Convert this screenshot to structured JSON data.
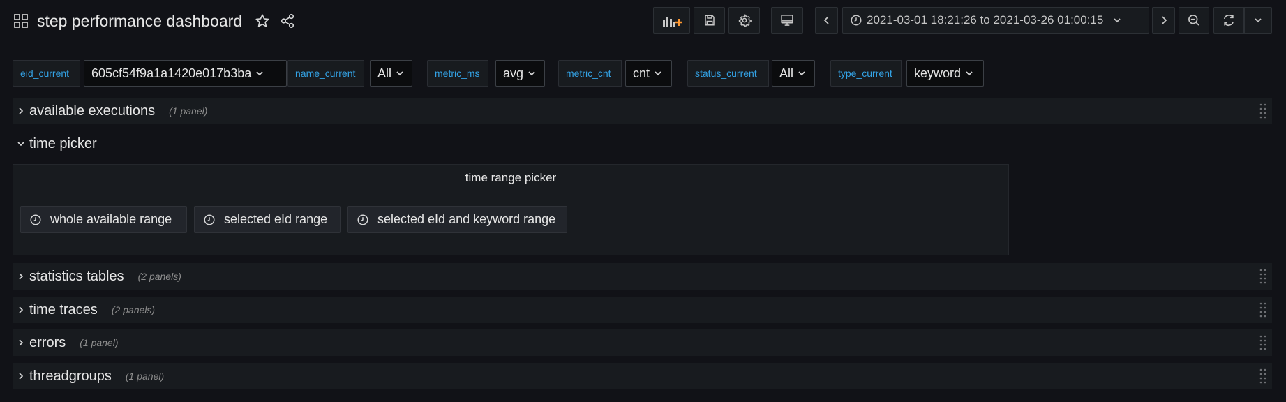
{
  "header": {
    "title": "step performance dashboard",
    "time_range": "2021-03-01 18:21:26 to 2021-03-26 01:00:15"
  },
  "toolbar": {
    "icons": [
      "add-panel-icon",
      "save-icon",
      "settings-icon",
      "tv-mode-icon",
      "chevron-left-icon",
      "clock-icon",
      "chevron-down-icon",
      "chevron-right-icon",
      "zoom-out-icon",
      "refresh-icon",
      "chevron-down-icon"
    ],
    "accent": "#ff9830"
  },
  "variables": [
    {
      "label": "eid_current",
      "value": "605cf54f9a1a1420e017b3ba"
    },
    {
      "label": "name_current",
      "value": "All"
    },
    {
      "label": "metric_ms",
      "value": "avg"
    },
    {
      "label": "metric_cnt",
      "value": "cnt"
    },
    {
      "label": "status_current",
      "value": "All"
    },
    {
      "label": "type_current",
      "value": "keyword"
    }
  ],
  "rows": [
    {
      "title": "available executions",
      "count": "(1 panel)",
      "collapsed": true
    },
    {
      "title": "time picker",
      "count": "",
      "collapsed": false
    },
    {
      "title": "statistics tables",
      "count": "(2 panels)",
      "collapsed": true
    },
    {
      "title": "time traces",
      "count": "(2 panels)",
      "collapsed": true
    },
    {
      "title": "errors",
      "count": "(1 panel)",
      "collapsed": true
    },
    {
      "title": "threadgroups",
      "count": "(1 panel)",
      "collapsed": true
    }
  ],
  "time_picker_panel": {
    "title": "time range picker",
    "buttons": [
      {
        "label": "whole available range"
      },
      {
        "label": "selected eId range"
      },
      {
        "label": "selected eId and keyword range"
      }
    ]
  },
  "colors": {
    "background": "#111217",
    "variable_label": "#33a2e5",
    "panel": "#181b1f"
  }
}
